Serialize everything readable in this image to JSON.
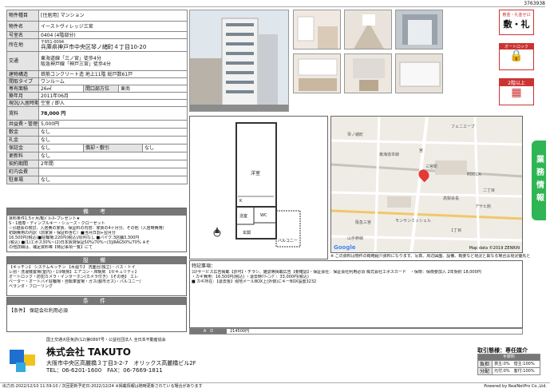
{
  "doc_id": "3763938",
  "table": {
    "type_label": "物件種目",
    "type_value": "[住居用] マンション",
    "name_label": "物件名",
    "name_value": "イーストヴィレッジ三宮",
    "room_label": "号室名",
    "room_value": "0404 (4階部分)",
    "address_label": "所在地",
    "postal": "〒651-0094",
    "address_value": "兵庫県神戸市中央区琴ノ緒町４丁目10-20",
    "transit_label": "交通",
    "transit_1": "東海道線「三ノ宮」徒歩4分",
    "transit_2": "阪急神戸線「神戸三宮」徒歩4分",
    "structure_label": "建物構造",
    "structure_value": "鉄筋コンクリート造 地上11階 総戸数61戸",
    "layout_label": "間取タイプ",
    "layout_value": "ワンルーム",
    "area_label": "専有面積",
    "area_value": "26㎡",
    "direction_label": "間口部方位",
    "direction_value": "東南",
    "built_label": "築年月",
    "built_value": "2011年06月",
    "status_label": "現況/入居時期",
    "status_value": "空室 / 即入",
    "rent_label": "賃料",
    "rent_value": "78,000 円",
    "mgmt_label": "共益費・管理費",
    "mgmt_value": "5,000円",
    "deposit_label": "敷金",
    "deposit_value": "なし",
    "key_label": "礼金",
    "key_value": "なし",
    "guarantee_label": "保証金",
    "guarantee_value": "なし",
    "amort_label": "償却・敷引",
    "amort_value": "なし",
    "renew_label": "更新料",
    "renew_value": "なし",
    "period_label": "契約期間",
    "period_value": "2年間",
    "assoc_label": "町内会費",
    "assoc_value": "",
    "parking_label": "駐車場",
    "parking_value": "なし"
  },
  "remarks": {
    "heading": "備 考",
    "lines": [
      "賃料条件1.5ヶ月/転ﾊﾞﾙｰﾀｰプレゼント★",
      "S・1階専・ディンプルキー・シューズ・クローゼット",
      "☆引越会の検討、入居費の家賃、保証料の内容：家賃の4ヶ月分、その他（入居時費用）",
      "初期費用の内訳（前家賃・保証料含む）■当月日割+翌月分",
      "16,500円(税込)■駐輪場:220円(税込)/原則なし ■バイク:3店舗3,300円",
      "(税込) ■(1)エポス30%~(2)日本賃貸保証50%/70%~(3)JRAG50%/70% ※そ",
      "の他詳細は、補足資料等【特記事項一覧】にて"
    ]
  },
  "equipment": {
    "heading": "設 備",
    "lines": [
      "【キッチン】 システムキッチン 【水廻り】 洗面台(独立)・バス・トイ",
      "レ別・洗濯機置場(室内)・【冷暖房】エアコン・床暖房 【セキュリティ】",
      "オートロック・防犯カメラ・インターホン(カメラ付き) 【その他】 エレ",
      "ベーター・オートバイ駐輪場・自転車置場・ガス(都市ガス)・バルコニー/",
      "ベランダ・フローリング"
    ]
  },
  "conditions": {
    "heading": "条 件",
    "text": "【条件】 保証会社利用必須"
  },
  "floorplan": {
    "room_label": "洋室",
    "balcony_label": "バルコニー",
    "bath_label": "浴室",
    "wc_label": "WC",
    "entrance_label": "玄関",
    "kitchen_label": "K"
  },
  "map": {
    "copyright": "Map data ©2019 ZENRIN",
    "credits": "Google",
    "places": [
      "フェニエーブ",
      "琴ノ緒町",
      "東海道本線",
      "宮",
      "三宮駅",
      "ROCCA",
      "高梨会長",
      "アサヒ館",
      "阪急三宮",
      "モンサンミッシェル",
      "山手幹線",
      "1丁目",
      "二丁目"
    ],
    "note": "※ この資料は物件の概略紹介資料になります。写真、周辺図面、設備、概要など現況と異なる場合は現況優先となります。"
  },
  "notes": {
    "heading": "特記事項：",
    "lines": [
      "ｺﾛﾅサービス広告掲載【許可】・チラシ、雑誌等掲載広告【要確認】・保証会社：保証会社利用必須 株式会社エポスカード　・保険：保険要加入 2年契約 18,000円",
      "・カギ費用：16,500円(税込) ・退去時ｸﾘｰﾆﾝｸﾞ：33,000円(税込)",
      "■ カギ所在：【退去後】現地メールBOX上(外側)にキーBOX設置3232"
    ],
    "ad_label": "A　D",
    "ad_value": "214500円"
  },
  "company": {
    "license": "国土交通大臣免許(12)第0897号・公益社団法人 全日本不動産協会",
    "name": "株式会社 TAKUTO",
    "address": "大阪市中央区高麗橋３丁目3-2-7　オリックス高麗橋ビル2F",
    "contact": "TEL：06-6201-1600　FAX：06-7669-1811"
  },
  "transaction": {
    "heading": "取引態様：専任媒介",
    "fee_heading": "手数料",
    "row1_label": "負担",
    "row1_value": "貸主:0%　借主:100%",
    "row2_label": "分配",
    "row2_value": "元付:0%　客付:100%"
  },
  "side_tab": "業務情報",
  "badges": {
    "b1": "敷金・礼金ゼロ",
    "b2": "オートロック",
    "b3": "2階以上"
  },
  "footer": {
    "left": "出力日:2022/12/10 11:59:10 / 次回更新予定日:2022/12/24 ※掲載情報は随時更新されている場合があります",
    "right": "Powered by RealNetPro Co.,Ltd."
  }
}
